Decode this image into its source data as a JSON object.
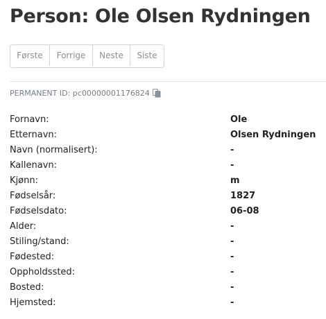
{
  "title": "Person: Ole Olsen Rydningen",
  "pager": {
    "first": "Første",
    "prev": "Forrige",
    "next": "Neste",
    "last": "Siste"
  },
  "permanent_id": {
    "label": "PERMANENT ID:",
    "value": "pc00000001176824",
    "icon": "copy-icon"
  },
  "fields": [
    {
      "label": "Fornavn:",
      "value": "Ole"
    },
    {
      "label": "Etternavn:",
      "value": "Olsen Rydningen"
    },
    {
      "label": "Navn (normalisert):",
      "value": "-"
    },
    {
      "label": "Kallenavn:",
      "value": "-"
    },
    {
      "label": "Kjønn:",
      "value": "m"
    },
    {
      "label": "Fødselsår:",
      "value": "1827"
    },
    {
      "label": "Fødselsdato:",
      "value": "06-08"
    },
    {
      "label": "Alder:",
      "value": "-"
    },
    {
      "label": "Stiling/stand:",
      "value": "-"
    },
    {
      "label": "Fødested:",
      "value": "-"
    },
    {
      "label": "Oppholdssted:",
      "value": "-"
    },
    {
      "label": "Bosted:",
      "value": "-"
    },
    {
      "label": "Hjemsted:",
      "value": "-"
    }
  ]
}
